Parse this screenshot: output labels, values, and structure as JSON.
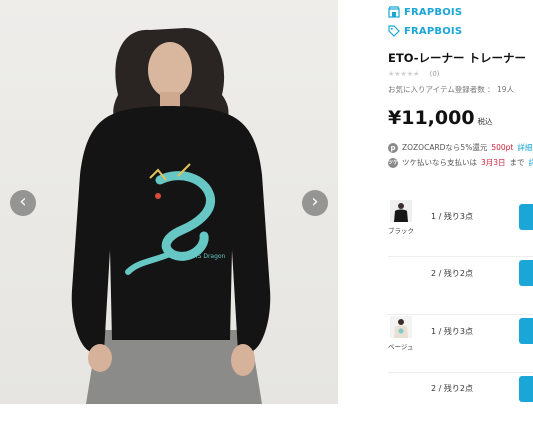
{
  "gallery": {
    "prev_icon": "chevron-left-icon",
    "next_icon": "chevron-right-icon",
    "print_text": "FRAPBOIS Dragon"
  },
  "brand": {
    "name_top": "FRAPBOIS",
    "name_bottom": "FRAPBOIS",
    "icon_top": "shop-icon",
    "icon_bottom": "tag-icon",
    "color": "#1aa6d6"
  },
  "product": {
    "title": "ETO-レーナー トレーナー",
    "review_count": "(0)",
    "favorites": "お気に入りアイテム登録者数 ： 19人",
    "price": "¥11,000",
    "tax_label": "税込"
  },
  "promos": [
    {
      "icon": "p",
      "prefix": "ZOZOCARDなら5%還元",
      "highlight": "500pt",
      "link": "詳細"
    },
    {
      "icon": "ツケ",
      "prefix": "ツケ払いなら支払いは",
      "highlight": "3月3日",
      "suffix": "まで",
      "link": "詳細"
    }
  ],
  "variants": [
    {
      "color_label": "ブラック",
      "stock": "1 / 残り3点"
    },
    {
      "color_label": "",
      "stock": "2 / 残り2点"
    },
    {
      "color_label": "ベージュ",
      "stock": "1 / 残り3点"
    },
    {
      "color_label": "",
      "stock": "2 / 残り2点"
    }
  ]
}
